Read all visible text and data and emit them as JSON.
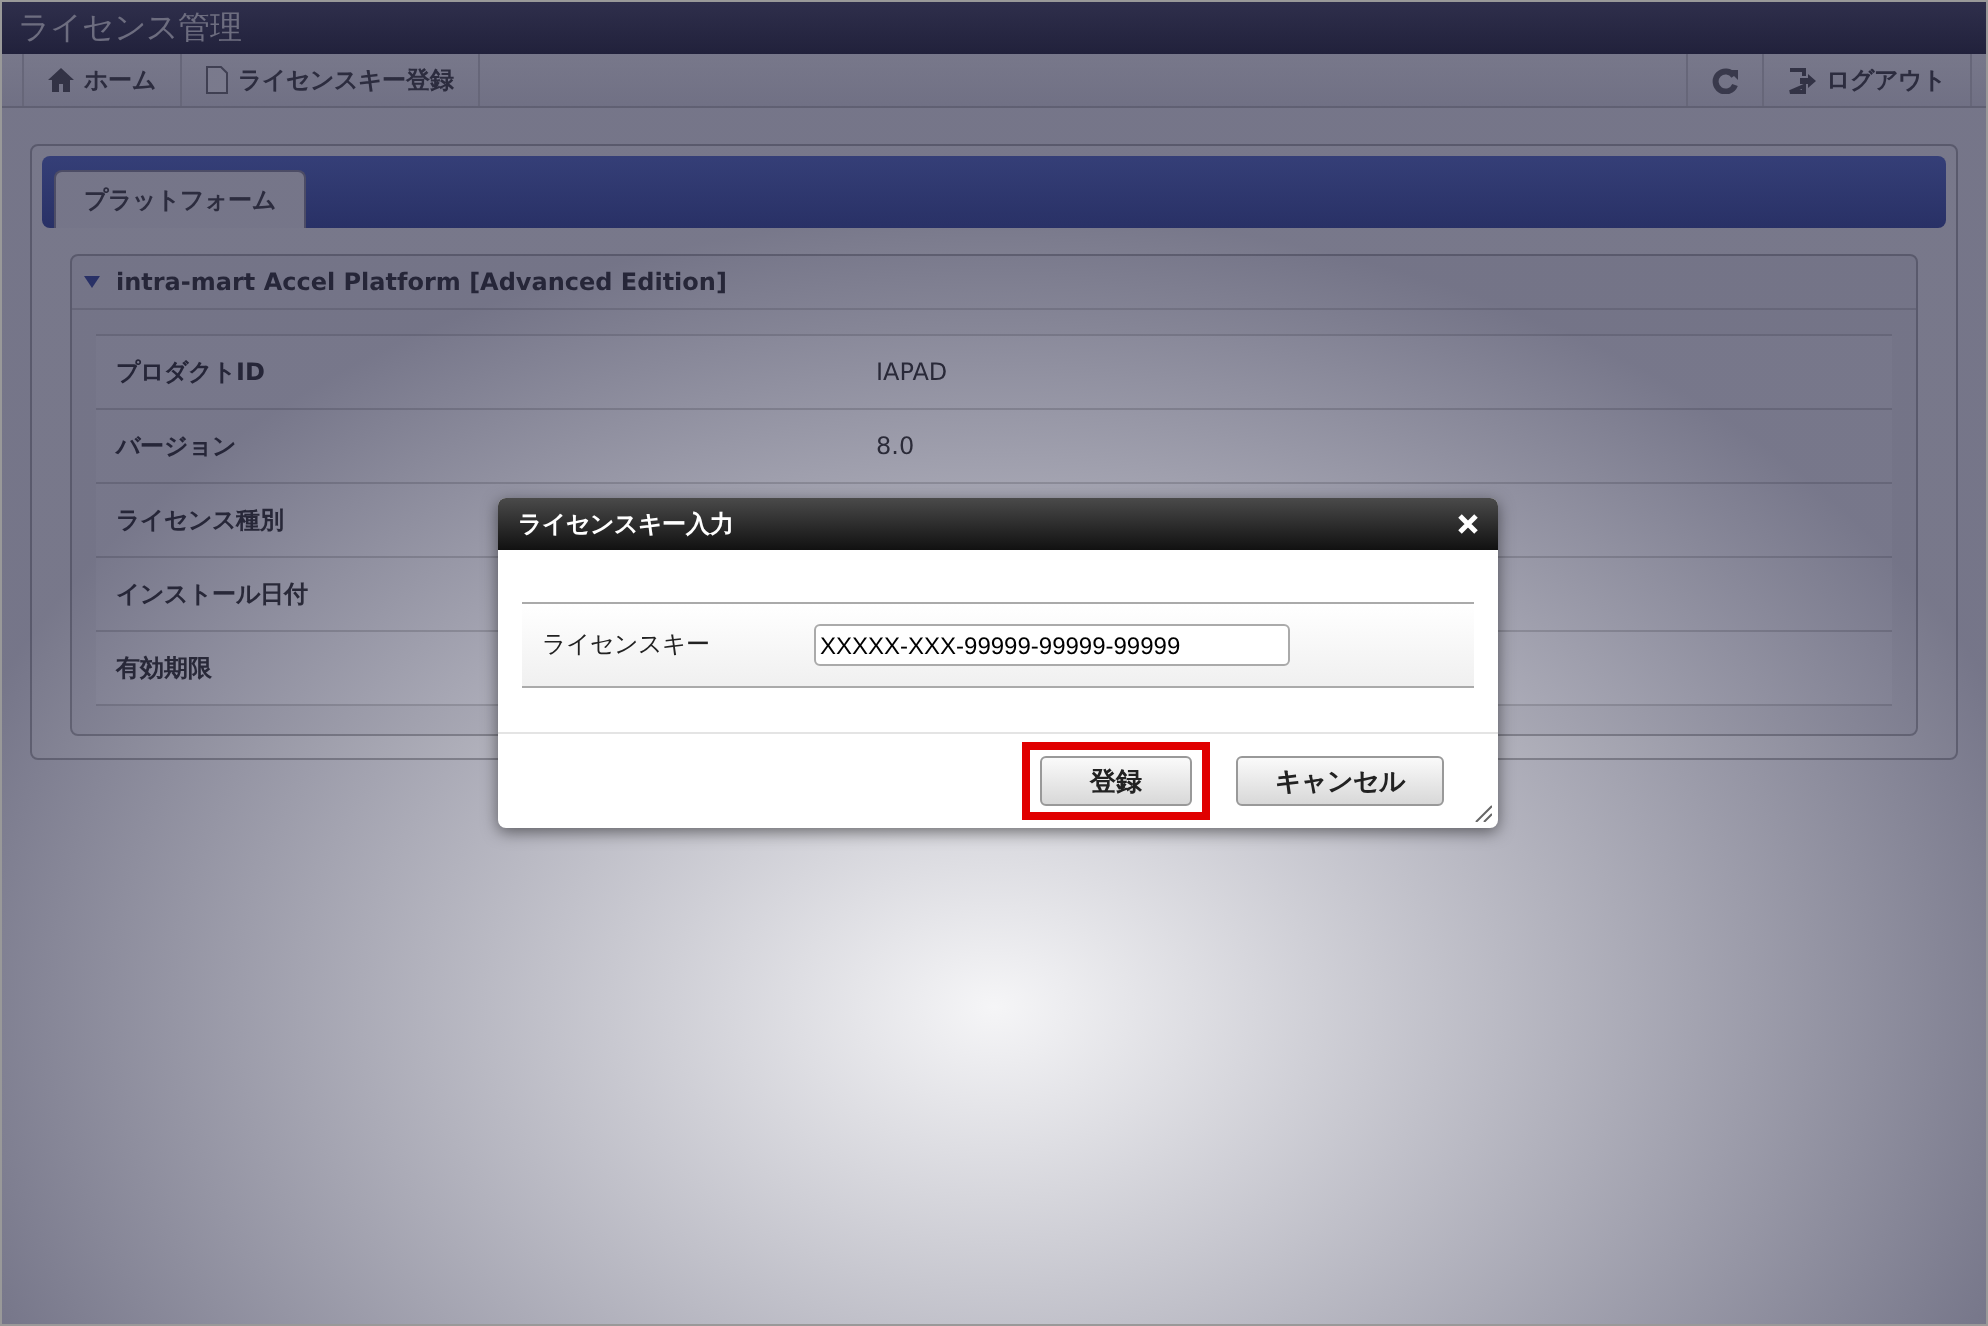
{
  "window": {
    "title": "ライセンス管理"
  },
  "toolbar": {
    "left": [
      {
        "kind": "home",
        "label": "ホーム"
      },
      {
        "kind": "page",
        "label": "ライセンスキー登録"
      }
    ],
    "right": [
      {
        "kind": "refresh"
      },
      {
        "kind": "logout",
        "label": "ログアウト"
      }
    ]
  },
  "tabs": [
    {
      "label": "プラットフォーム",
      "selected": true
    }
  ],
  "section": {
    "title": "intra-mart Accel Platform [Advanced Edition]",
    "expanded": true,
    "rows": [
      {
        "label": "プロダクトID",
        "value": "IAPAD"
      },
      {
        "label": "バージョン",
        "value": "8.0"
      },
      {
        "label": "ライセンス種別"
      },
      {
        "label": "インストール日付"
      },
      {
        "label": "有効期限"
      }
    ]
  },
  "dialog": {
    "title": "ライセンスキー入力",
    "field": {
      "label": "ライセンスキー",
      "value": "XXXXX-XXX-99999-99999-99999"
    },
    "buttons": [
      {
        "label": "登録",
        "highlighted": true
      },
      {
        "label": "キャンセル",
        "highlighted": false
      }
    ]
  }
}
